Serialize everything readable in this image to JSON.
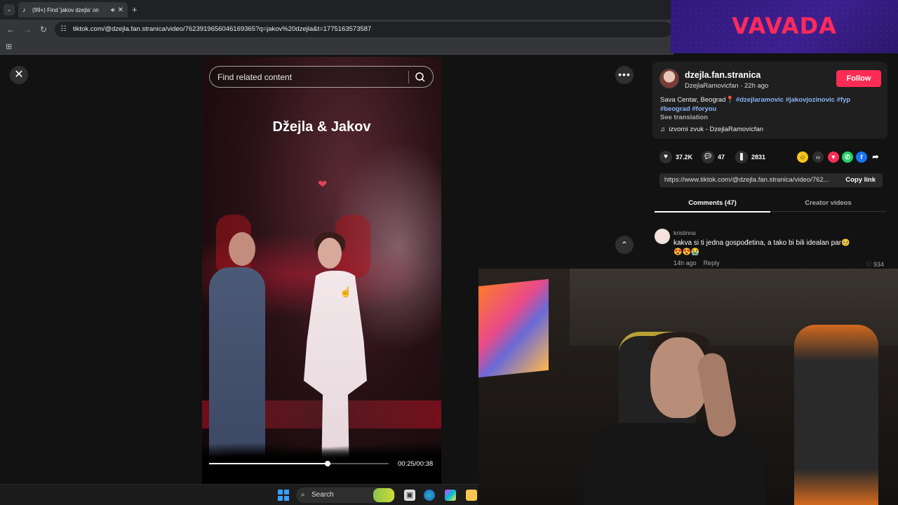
{
  "browser": {
    "tab_title": "(99+) Find 'jakov dzejla' on",
    "tab_icon": "tiktok-icon",
    "url": "tiktok.com/@dzejla.fan.stranica/video/7623919656046169365?q=jakov%20dzejla&t=1775163573587"
  },
  "ad": {
    "brand": "VAVADA",
    "brand_color": "#ff2a5c"
  },
  "video": {
    "search_placeholder": "Find related content",
    "overlay_title": "Džejla & Jakov",
    "timecode": "00:25/00:38",
    "progress": 0.66
  },
  "post": {
    "username": "dzejla.fan.stranica",
    "subline": "DzejlaRamovicfan · 22h ago",
    "follow_label": "Follow",
    "location": "Sava Centar, Beograd📍",
    "hashtags_line1": "#dzejlaramovic #jakovjozinovic #fyp",
    "hashtags_line2": "#beograd #foryou",
    "see_translation": "See translation",
    "music": "izvorni zvuk - DzejlaRamovicfan",
    "likes": "37.2K",
    "comments": "47",
    "saves": "2831",
    "share_link": "https://www.tiktok.com/@dzejla.fan.stranica/video/762...",
    "copy_link_label": "Copy link",
    "accent_color": "#fe2c55"
  },
  "tabs": {
    "comments_label": "Comments (47)",
    "creator_label": "Creator videos"
  },
  "comment": {
    "user": "kristinna",
    "text": "kakva si ti jedna gospođetina, a tako bi bili idealan par🥺",
    "emojis": "😍😍😭",
    "time": "14h ago",
    "reply_label": "Reply",
    "likes": "♡ 934"
  },
  "taskbar": {
    "search_label": "Search"
  }
}
